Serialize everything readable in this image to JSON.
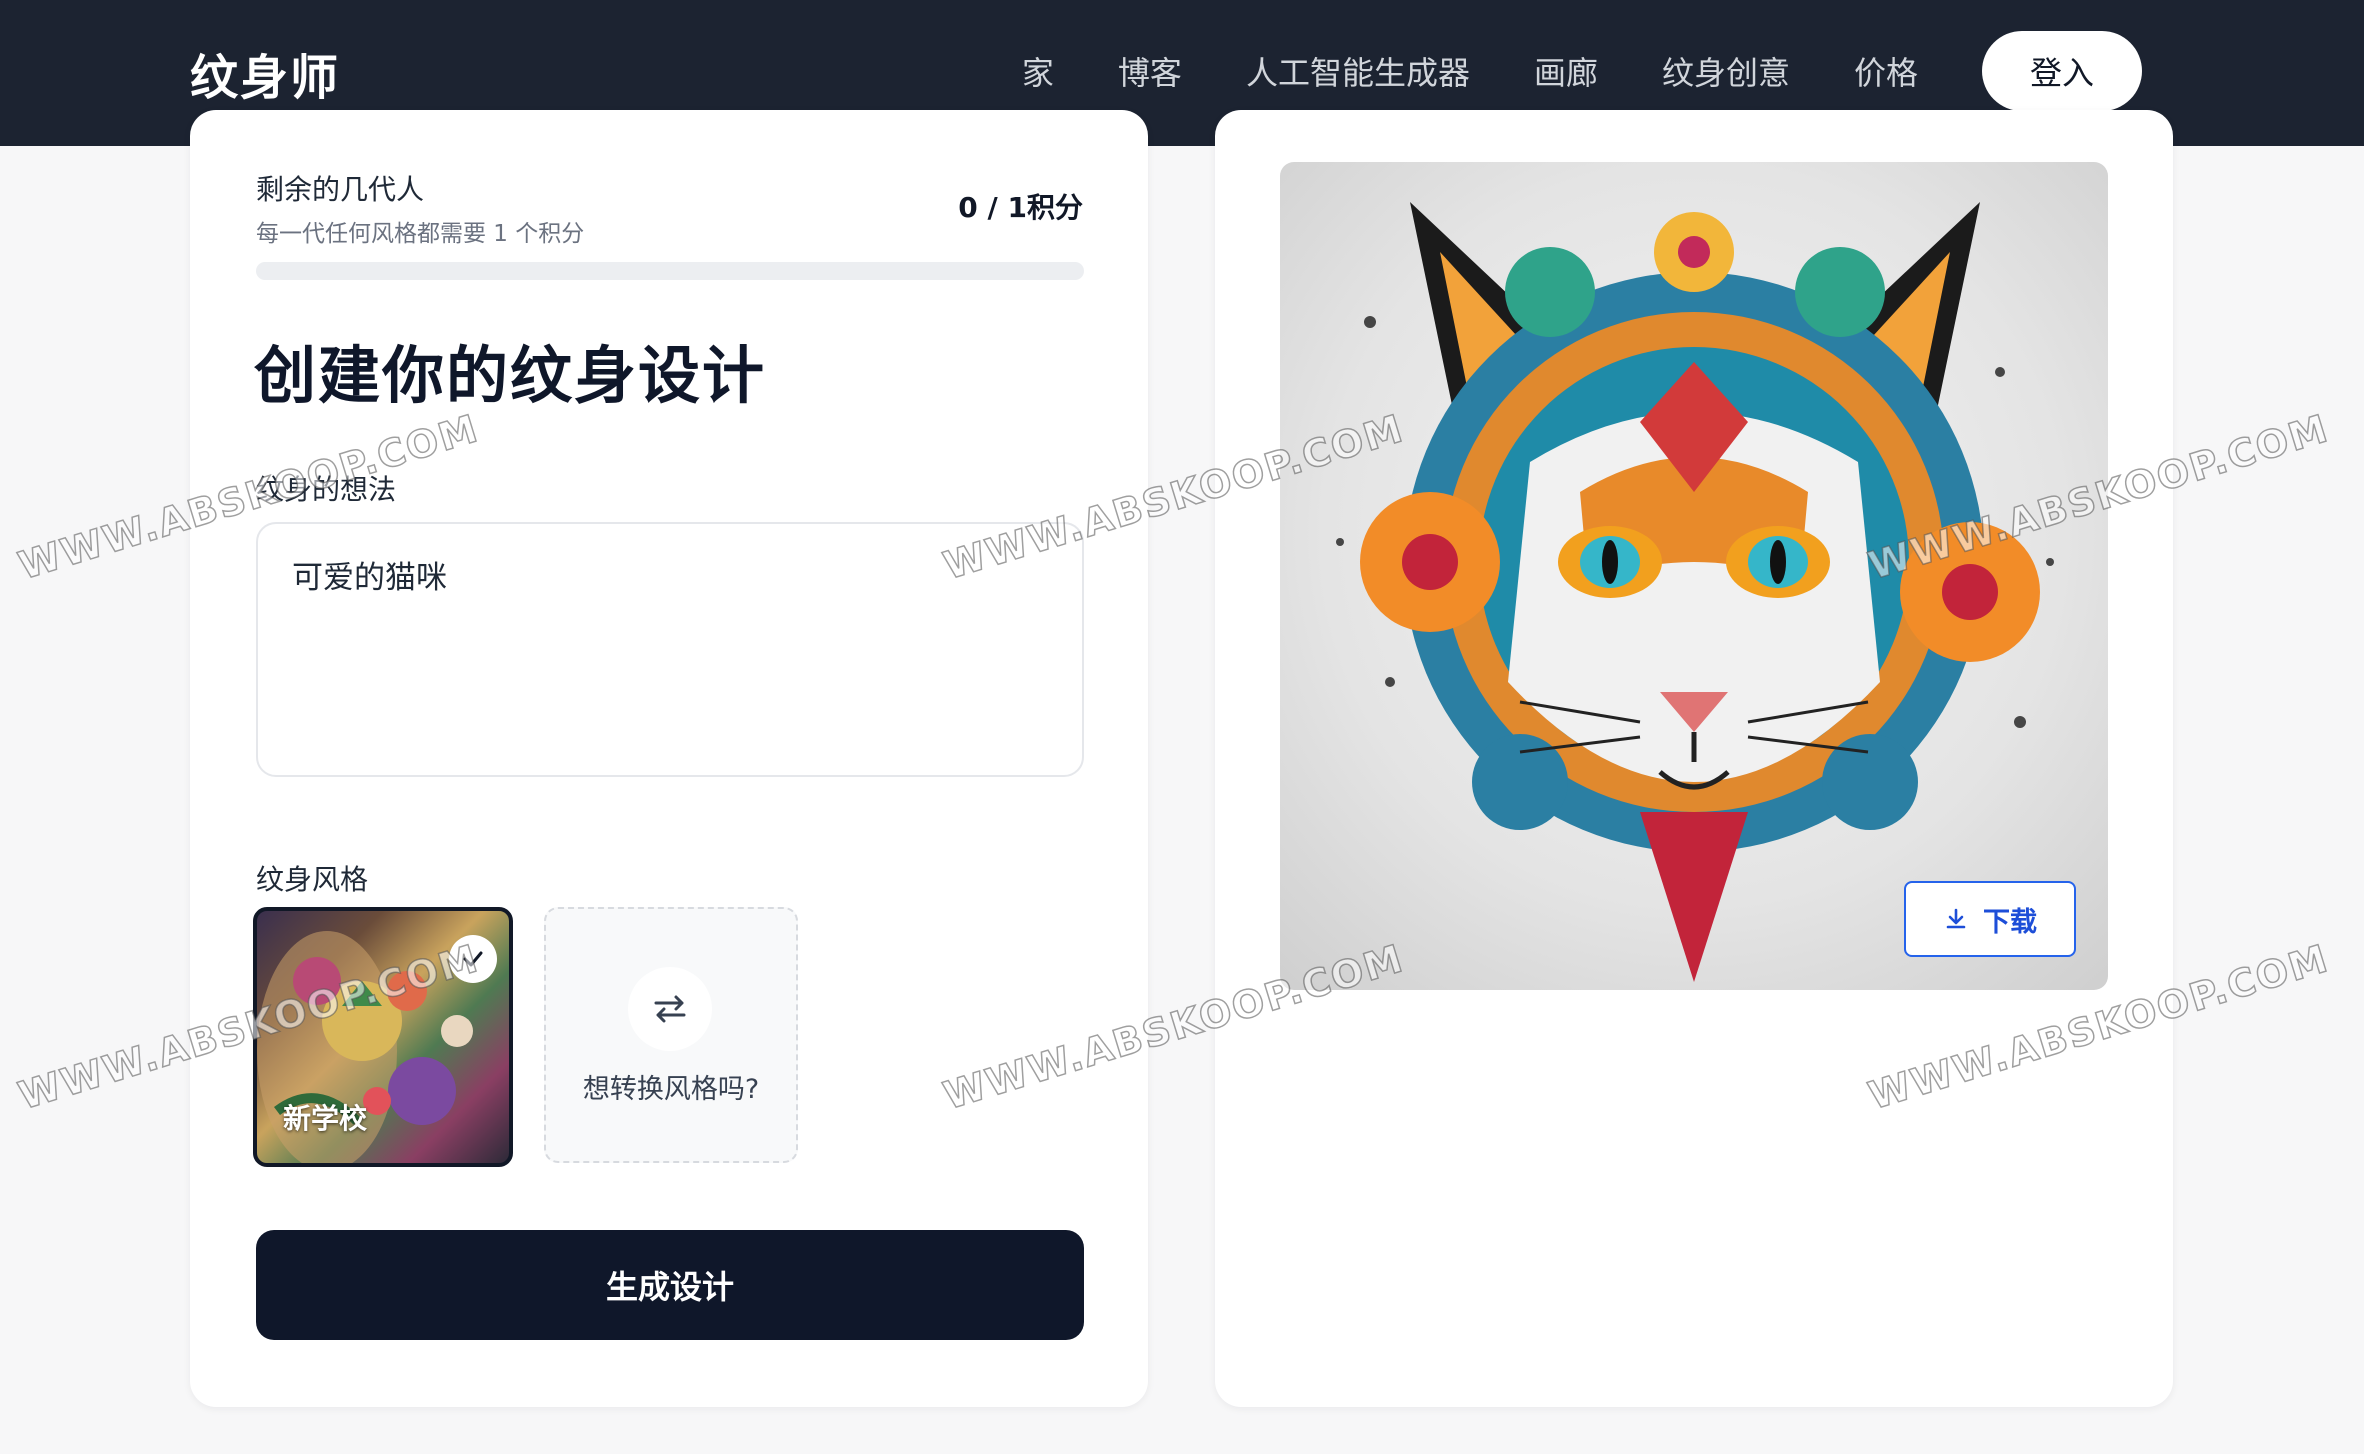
{
  "header": {
    "brand": "纹身师",
    "nav": [
      "家",
      "博客",
      "人工智能生成器",
      "画廊",
      "纹身创意",
      "价格"
    ],
    "login_label": "登入"
  },
  "credits": {
    "title": "剩余的几代人",
    "subtitle": "每一代任何风格都需要 1 个积分",
    "count": "0 / 1积分",
    "progress_fraction": 0
  },
  "form": {
    "heading": "创建你的纹身设计",
    "idea_label": "纹身的想法",
    "idea_value": "可爱的猫咪",
    "style_label": "纹身风格",
    "styles": [
      {
        "name": "新学校",
        "selected": true
      },
      {
        "name": "想转换风格吗?",
        "selected": false
      }
    ],
    "generate_label": "生成设计"
  },
  "result": {
    "download_label": "下载"
  },
  "watermark": "WWW.ABSKOOP.COM",
  "colors": {
    "header_bg": "#1c2331",
    "primary_dark": "#0f172a",
    "download_accent": "#2563eb"
  }
}
